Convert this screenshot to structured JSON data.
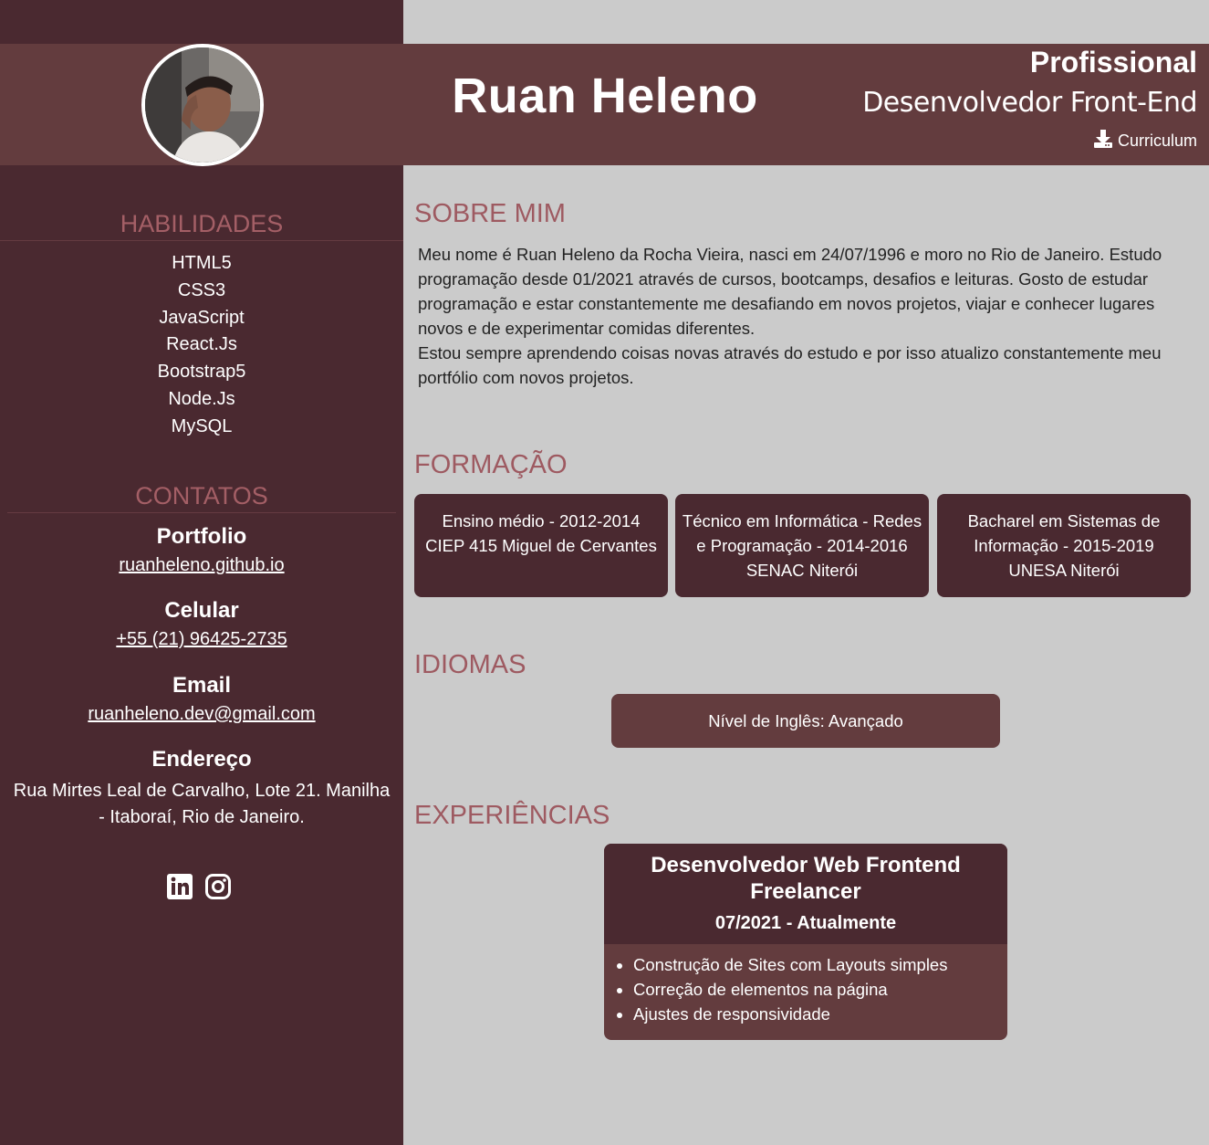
{
  "header": {
    "name": "Ruan Heleno",
    "title": "Profissional",
    "role": "Desenvolvedor Front-End",
    "cv_link": "Curriculum",
    "cv_icon": "download-icon"
  },
  "sidebar": {
    "skills_heading": "HABILIDADES",
    "skills": [
      "HTML5",
      "CSS3",
      "JavaScript",
      "React.Js",
      "Bootstrap5",
      "Node.Js",
      "MySQL"
    ],
    "contacts_heading": "CONTATOS",
    "portfolio_label": "Portfolio",
    "portfolio_value": "ruanheleno.github.io",
    "phone_label": "Celular",
    "phone_value": "+55 (21) 96425-2735",
    "email_label": "Email",
    "email_value": "ruanheleno.dev@gmail.com",
    "address_label": "Endereço",
    "address_value": "Rua Mirtes Leal de Carvalho, Lote 21. Manilha - Itaboraí, Rio de Janeiro.",
    "social_icons": [
      "linkedin-icon",
      "instagram-icon"
    ]
  },
  "about": {
    "heading": "SOBRE MIM",
    "paragraph1": "Meu nome é Ruan Heleno da Rocha Vieira, nasci em 24/07/1996 e moro no Rio de Janeiro. Estudo programação desde 01/2021 através de cursos, bootcamps, desafios e leituras. Gosto de estudar programação e estar constantemente me desafiando em novos projetos, viajar e conhecer lugares novos e de experimentar comidas diferentes.",
    "paragraph2": "Estou sempre aprendendo coisas novas através do estudo e por isso atualizo constantemente meu portfólio com novos projetos."
  },
  "education": {
    "heading": "FORMAÇÃO",
    "items": [
      {
        "line1": "Ensino médio - 2012-2014",
        "line2": "CIEP 415 Miguel de Cervantes",
        "line3": ""
      },
      {
        "line1": "Técnico em Informática - Redes",
        "line2": "e Programação - 2014-2016",
        "line3": "SENAC Niterói"
      },
      {
        "line1": "Bacharel em Sistemas de",
        "line2": "Informação - 2015-2019",
        "line3": "UNESA Niterói"
      }
    ]
  },
  "languages": {
    "heading": "IDIOMAS",
    "english": "Nível de Inglês: Avançado"
  },
  "experience": {
    "heading": "EXPERIÊNCIAS",
    "title_line1": "Desenvolvedor Web Frontend",
    "title_line2": "Freelancer",
    "period": "07/2021 - Atualmente",
    "tasks": [
      "Construção de Sites com Layouts simples",
      "Correção de elementos na página",
      "Ajustes de responsividade"
    ]
  },
  "colors": {
    "sidebar": "#4a2930",
    "header": "#633c3e",
    "accent": "#a45f66",
    "background": "#cbcbcb"
  }
}
